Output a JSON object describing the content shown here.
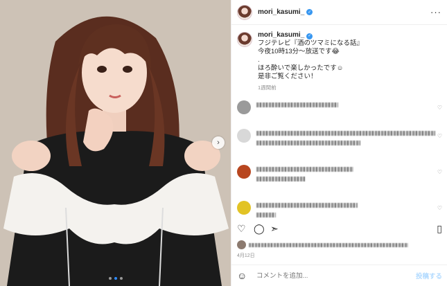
{
  "post": {
    "username": "mori_kasumi_",
    "caption_lines": [
      "フジテレビ『酒のツマミになる話』",
      "今夜10時13分〜放送です😂",
      ".",
      "ほろ酔いで楽しかったです☺",
      "是非ご覧ください！"
    ],
    "caption_time": "1週間前",
    "date": "4月12日",
    "more_icon": "more-horizontal-icon",
    "photo_dots": 3,
    "active_dot": 1
  },
  "comment_bar": {
    "placeholder": "コメントを追加...",
    "post_label": "投稿する"
  },
  "colors": {
    "verified": "#3897f0",
    "dot_active": "#2e8bff",
    "post_button": "#b3dbff"
  }
}
